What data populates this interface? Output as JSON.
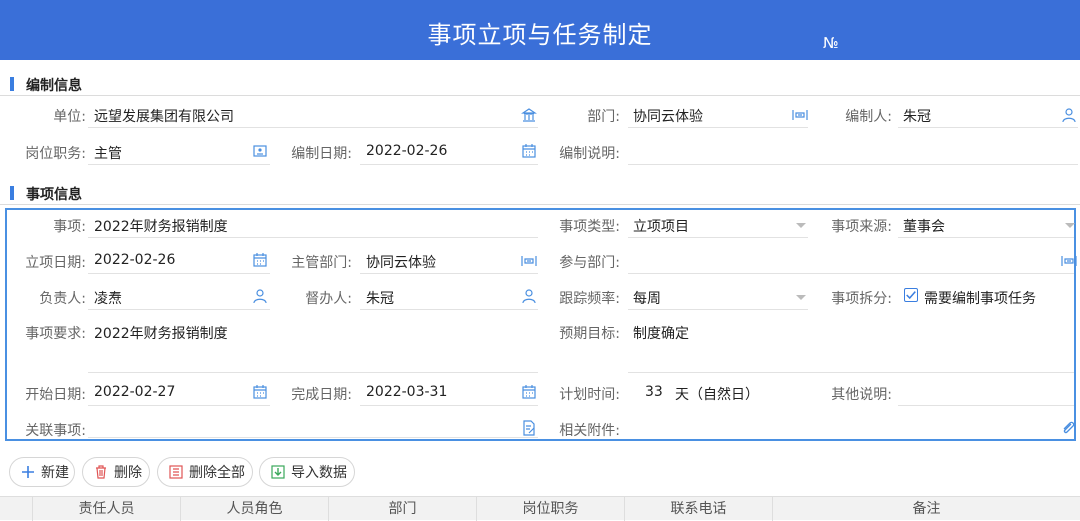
{
  "header": {
    "title": "事项立项与任务制定",
    "no_label": "№"
  },
  "sections": {
    "compile": "编制信息",
    "item": "事项信息"
  },
  "compile": {
    "unit_label": "单位:",
    "unit_value": "远望发展集团有限公司",
    "dept_label": "部门:",
    "dept_value": "协同云体验",
    "author_label": "编制人:",
    "author_value": "朱冠",
    "post_label": "岗位职务:",
    "post_value": "主管",
    "date_label": "编制日期:",
    "date_value": "2022-02-26",
    "note_label": "编制说明:",
    "note_value": ""
  },
  "item": {
    "name_label": "事项:",
    "name_value": "2022年财务报销制度",
    "type_label": "事项类型:",
    "type_value": "立项项目",
    "source_label": "事项来源:",
    "source_value": "董事会",
    "setup_date_label": "立项日期:",
    "setup_date_value": "2022-02-26",
    "main_dept_label": "主管部门:",
    "main_dept_value": "协同云体验",
    "join_dept_label": "参与部门:",
    "join_dept_value": "",
    "owner_label": "负责人:",
    "owner_value": "凌焘",
    "supervisor_label": "督办人:",
    "supervisor_value": "朱冠",
    "freq_label": "跟踪频率:",
    "freq_value": "每周",
    "split_label": "事项拆分:",
    "split_value": "需要编制事项任务",
    "req_label": "事项要求:",
    "req_value": "2022年财务报销制度",
    "goal_label": "预期目标:",
    "goal_value": "制度确定",
    "start_label": "开始日期:",
    "start_value": "2022-02-27",
    "end_label": "完成日期:",
    "end_value": "2022-03-31",
    "plan_label": "计划时间:",
    "plan_days": "33",
    "plan_unit": "天（自然日）",
    "other_label": "其他说明:",
    "other_value": "",
    "related_label": "关联事项:",
    "related_value": "",
    "attach_label": "相关附件:",
    "attach_value": ""
  },
  "toolbar": {
    "new": "新建",
    "delete": "删除",
    "delete_all": "删除全部",
    "import": "导入数据"
  },
  "table": {
    "columns": [
      "责任人员",
      "人员角色",
      "部门",
      "岗位职务",
      "联系电话",
      "备注"
    ]
  },
  "colors": {
    "header_bg": "#3a6fd8",
    "accent": "#3a7ee0",
    "box_border": "#4a90e2",
    "icon": "#4a8fe0"
  }
}
